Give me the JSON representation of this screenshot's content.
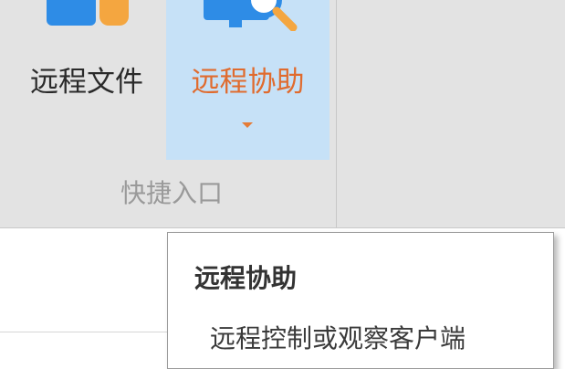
{
  "ribbon": {
    "buttons": [
      {
        "label": "远程文件",
        "icon": "remote-files-icon"
      },
      {
        "label": "远程协助",
        "icon": "remote-assist-icon",
        "state": "hovered",
        "has_dropdown": true
      }
    ],
    "group_label": "快捷入口"
  },
  "tooltip": {
    "title": "远程协助",
    "description": "远程控制或观察客户端"
  },
  "colors": {
    "ribbon_bg": "#e3e3e3",
    "hover_bg": "#c6e1f7",
    "accent_orange": "#e06b2e",
    "icon_blue": "#2e8ce6",
    "icon_orange": "#f4a640"
  }
}
